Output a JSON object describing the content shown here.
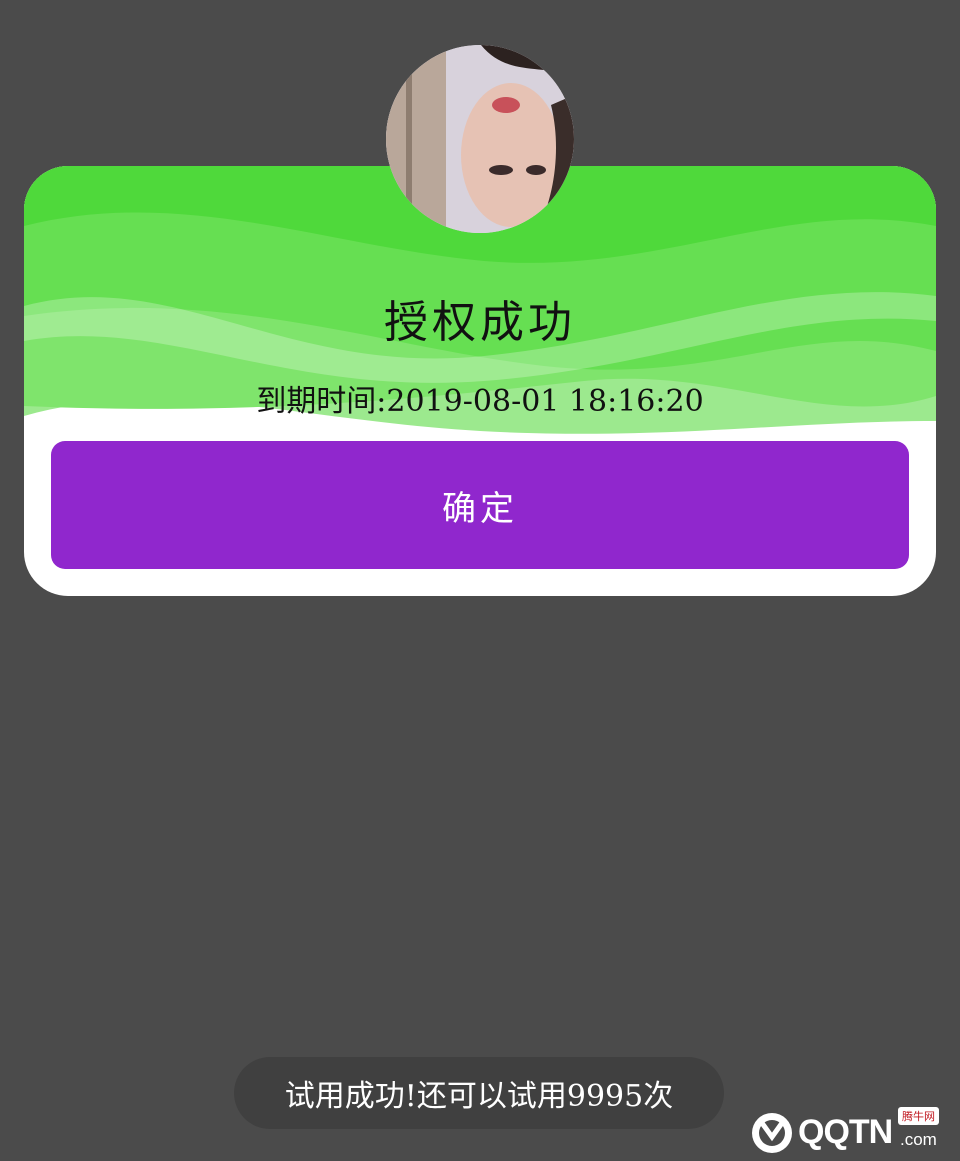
{
  "dialog": {
    "title": "授权成功",
    "expiry_text": "到期时间:2019-08-01 18:16:20",
    "confirm_label": "确定"
  },
  "toast": {
    "message": "试用成功!还可以试用9995次"
  },
  "watermark": {
    "brand": "QQTN",
    "suffix": ".com",
    "tag": "腾牛网"
  },
  "colors": {
    "background": "#4b4b4b",
    "header_green": "#55dd44",
    "confirm_purple": "#9027cd",
    "toast_bg": "#404040"
  },
  "icons": {
    "avatar": "user-avatar-photo",
    "watermark_logo": "qqtn-logo-icon"
  }
}
